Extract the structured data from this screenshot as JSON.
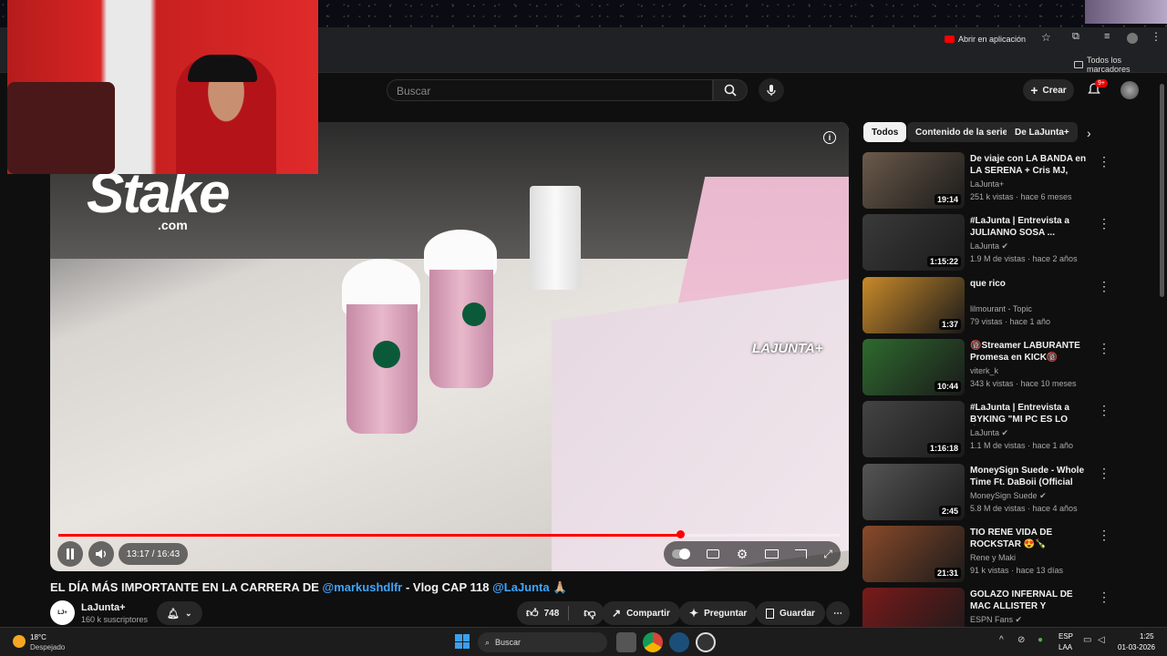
{
  "browser": {
    "open_in_app": "Abrir en aplicación",
    "bookmarks_label": "Todos los marcadores"
  },
  "header": {
    "search_placeholder": "Buscar",
    "create_label": "Crear",
    "notifications_badge": "9+"
  },
  "video": {
    "time": "13:17 / 16:43",
    "progress": 0.795,
    "title_prefix": "EL DÍA MÁS IMPORTANTE EN LA CARRERA DE ",
    "title_mention1": "@markushdlfr",
    "title_mid": " - Vlog CAP 118 ",
    "title_mention2": "@LaJunta",
    "title_emoji": "🙏🏼",
    "stake_logo": "Stake",
    "stake_sub": ".com",
    "watermark": "LAJUNTA+"
  },
  "channel": {
    "name": "LaJunta+",
    "subs": "160 k suscriptores",
    "likes": "748",
    "share": "Compartir",
    "ask": "Preguntar",
    "save": "Guardar"
  },
  "chips": [
    "Todos",
    "Contenido de la serie",
    "De LaJunta+"
  ],
  "recommendations": [
    {
      "title": "De viaje con LA BANDA en LA SERENA + Cris MJ, Floyymeno...",
      "channel": "LaJunta+",
      "meta": "251 k vistas · hace 6 meses",
      "duration": "19:14",
      "verified": false,
      "color": "#6b5a4a"
    },
    {
      "title": "#LaJunta | Entrevista a JULIANNO SOSA ...",
      "channel": "LaJunta",
      "meta": "1.9 M de vistas · hace 2 años",
      "duration": "1:15:22",
      "verified": true,
      "color": "#3a3a3a"
    },
    {
      "title": "que rico",
      "channel": "lilmourant - Topic",
      "meta": "79 vistas · hace 1 año",
      "duration": "1:37",
      "verified": false,
      "color": "#c98a2a"
    },
    {
      "title": "🔞Streamer LABURANTE Promesa en KICK🔞",
      "channel": "viterk_k",
      "meta": "343 k vistas · hace 10 meses",
      "duration": "10:44",
      "verified": false,
      "color": "#2e6a2e"
    },
    {
      "title": "#LaJunta | Entrevista a BYKING \"MI PC ES LO ÚNICO QUE ME ...",
      "channel": "LaJunta",
      "meta": "1.1 M de vistas · hace 1 año",
      "duration": "1:16:18",
      "verified": true,
      "color": "#444"
    },
    {
      "title": "MoneySign Suede - Whole Time Ft. DaBoii (Official Video)",
      "channel": "MoneySign Suede",
      "meta": "5.8 M de vistas · hace 4 años",
      "duration": "2:45",
      "verified": true,
      "color": "#555"
    },
    {
      "title": "TIO RENE VIDA DE ROCKSTAR 😍🍾",
      "channel": "Rene y Maki",
      "meta": "91 k vistas · hace 13 días",
      "duration": "21:31",
      "verified": false,
      "color": "#8a4a2a"
    },
    {
      "title": "GOLAZO INFERNAL DE MAC ALLISTER Y PARTIDAZO TOTA...",
      "channel": "ESPN Fans",
      "meta": "",
      "duration": "",
      "verified": true,
      "color": "#7a1a1a"
    }
  ],
  "taskbar": {
    "temp": "18°C",
    "weather": "Despejado",
    "search": "Buscar",
    "lang1": "ESP",
    "lang2": "LAA",
    "clock": "1:25",
    "date": "01-03-2026"
  }
}
